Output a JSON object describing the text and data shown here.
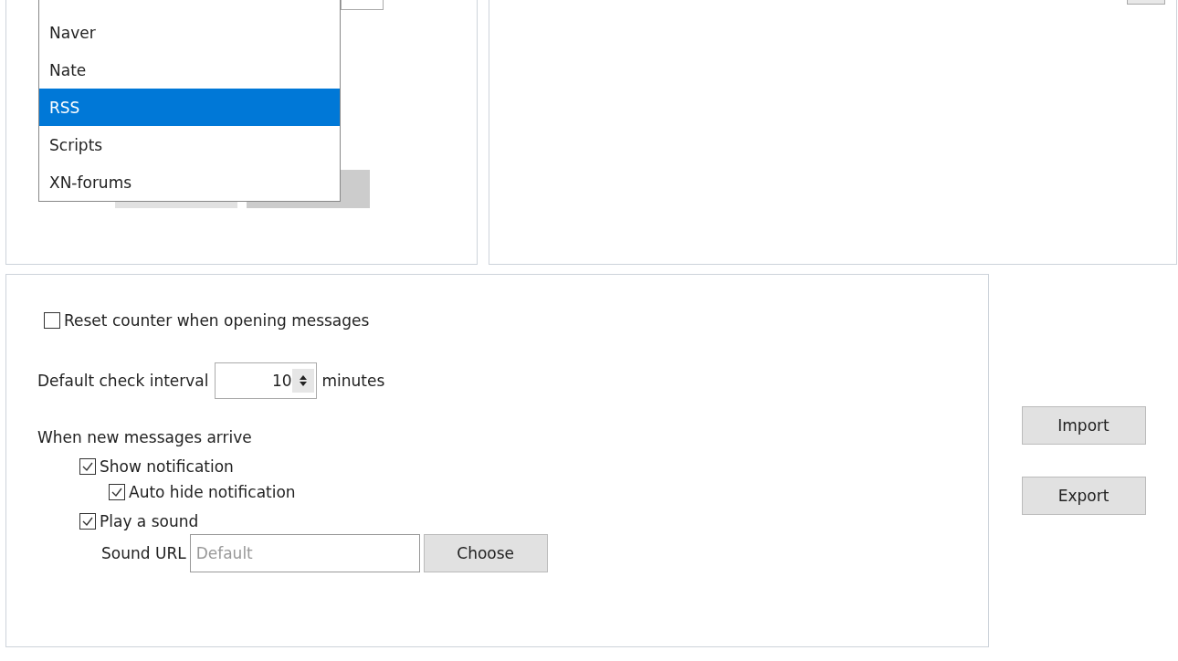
{
  "dropdown": {
    "items": [
      {
        "label": "Naver",
        "selected": false
      },
      {
        "label": "Nate",
        "selected": false
      },
      {
        "label": "RSS",
        "selected": true
      },
      {
        "label": "Scripts",
        "selected": false
      },
      {
        "label": "XN-forums",
        "selected": false
      }
    ]
  },
  "settings": {
    "reset_counter": {
      "label": "Reset counter when opening messages",
      "checked": false
    },
    "check_interval": {
      "label": "Default check interval",
      "value": "10",
      "unit": "minutes"
    },
    "new_messages": {
      "label": "When new messages arrive",
      "options": [
        {
          "label": "Show notification",
          "checked": true,
          "children": [
            {
              "label": "Auto hide notification",
              "checked": true
            }
          ]
        },
        {
          "label": "Play a sound",
          "checked": true
        }
      ]
    },
    "sound_url": {
      "label": "Sound URL",
      "placeholder": "Default",
      "button": "Choose"
    }
  },
  "side_buttons": [
    "Import",
    "Export"
  ]
}
